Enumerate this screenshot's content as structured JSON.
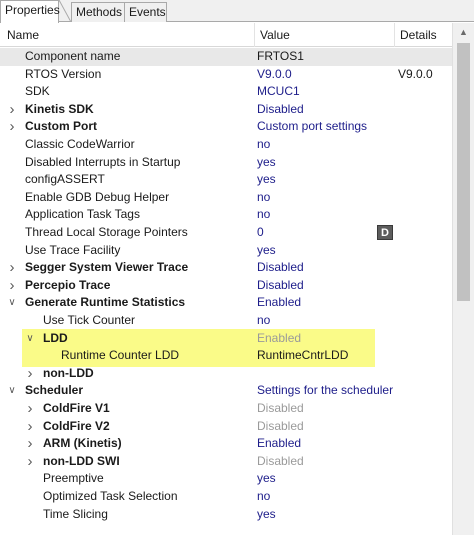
{
  "tabs": [
    {
      "label": "Properties",
      "active": true
    },
    {
      "label": "Methods",
      "active": false
    },
    {
      "label": "Events",
      "active": false
    }
  ],
  "columns": {
    "name": "Name",
    "value": "Value",
    "details": "Details"
  },
  "rows": [
    {
      "name": "Component name",
      "value": "FRTOS1",
      "details": "",
      "indent": 0,
      "twisty": "",
      "bold": false,
      "dim": false,
      "value_style": "dark",
      "selected": true
    },
    {
      "name": "RTOS Version",
      "value": "V9.0.0",
      "details": "V9.0.0",
      "indent": 0,
      "twisty": "",
      "bold": false,
      "dim": false,
      "value_style": "blue"
    },
    {
      "name": "SDK",
      "value": "MCUC1",
      "details": "",
      "indent": 0,
      "twisty": "",
      "bold": false,
      "dim": false,
      "value_style": "blue"
    },
    {
      "name": "Kinetis SDK",
      "value": "Disabled",
      "details": "",
      "indent": 0,
      "twisty": "collapsed",
      "bold": true,
      "dim": false,
      "value_style": "blue"
    },
    {
      "name": "Custom Port",
      "value": "Custom port settings",
      "details": "",
      "indent": 0,
      "twisty": "collapsed",
      "bold": true,
      "dim": false,
      "value_style": "blue"
    },
    {
      "name": "Classic CodeWarrior",
      "value": "no",
      "details": "",
      "indent": 0,
      "twisty": "",
      "bold": false,
      "dim": false,
      "value_style": "blue"
    },
    {
      "name": "Disabled Interrupts in Startup",
      "value": "yes",
      "details": "",
      "indent": 0,
      "twisty": "",
      "bold": false,
      "dim": false,
      "value_style": "blue"
    },
    {
      "name": "configASSERT",
      "value": "yes",
      "details": "",
      "indent": 0,
      "twisty": "",
      "bold": false,
      "dim": false,
      "value_style": "blue"
    },
    {
      "name": "Enable GDB Debug Helper",
      "value": "no",
      "details": "",
      "indent": 0,
      "twisty": "",
      "bold": false,
      "dim": false,
      "value_style": "blue"
    },
    {
      "name": "Application Task Tags",
      "value": "no",
      "details": "",
      "indent": 0,
      "twisty": "",
      "bold": false,
      "dim": false,
      "value_style": "blue"
    },
    {
      "name": "Thread Local Storage Pointers",
      "value": "0",
      "details": "",
      "indent": 0,
      "twisty": "",
      "bold": false,
      "dim": false,
      "value_style": "blue",
      "button": "D"
    },
    {
      "name": "Use Trace Facility",
      "value": "yes",
      "details": "",
      "indent": 0,
      "twisty": "",
      "bold": false,
      "dim": false,
      "value_style": "blue"
    },
    {
      "name": "Segger System Viewer Trace",
      "value": "Disabled",
      "details": "",
      "indent": 0,
      "twisty": "collapsed",
      "bold": true,
      "dim": false,
      "value_style": "blue"
    },
    {
      "name": "Percepio Trace",
      "value": "Disabled",
      "details": "",
      "indent": 0,
      "twisty": "collapsed",
      "bold": true,
      "dim": false,
      "value_style": "blue"
    },
    {
      "name": "Generate Runtime Statistics",
      "value": "Enabled",
      "details": "",
      "indent": 0,
      "twisty": "expanded",
      "bold": true,
      "dim": false,
      "value_style": "blue"
    },
    {
      "name": "Use Tick Counter",
      "value": "no",
      "details": "",
      "indent": 1,
      "twisty": "",
      "bold": false,
      "dim": false,
      "value_style": "blue"
    },
    {
      "name": "LDD",
      "value": "Enabled",
      "details": "",
      "indent": 1,
      "twisty": "expanded",
      "bold": true,
      "dim": false,
      "value_style": "dim"
    },
    {
      "name": "Runtime Counter LDD",
      "value": "RuntimeCntrLDD",
      "details": "",
      "indent": 2,
      "twisty": "",
      "bold": false,
      "dim": false,
      "value_style": "dark"
    },
    {
      "name": "non-LDD",
      "value": "",
      "details": "",
      "indent": 1,
      "twisty": "collapsed",
      "bold": true,
      "dim": false,
      "value_style": "blue"
    },
    {
      "name": "Scheduler",
      "value": "Settings for the scheduler",
      "details": "",
      "indent": 0,
      "twisty": "expanded",
      "bold": true,
      "dim": false,
      "value_style": "blue"
    },
    {
      "name": "ColdFire V1",
      "value": "Disabled",
      "details": "",
      "indent": 1,
      "twisty": "collapsed",
      "bold": true,
      "dim": false,
      "value_style": "dim"
    },
    {
      "name": "ColdFire V2",
      "value": "Disabled",
      "details": "",
      "indent": 1,
      "twisty": "collapsed",
      "bold": true,
      "dim": false,
      "value_style": "dim"
    },
    {
      "name": "ARM (Kinetis)",
      "value": "Enabled",
      "details": "",
      "indent": 1,
      "twisty": "collapsed",
      "bold": true,
      "dim": false,
      "value_style": "blue"
    },
    {
      "name": "non-LDD SWI",
      "value": "Disabled",
      "details": "",
      "indent": 1,
      "twisty": "collapsed",
      "bold": true,
      "dim": false,
      "value_style": "dim"
    },
    {
      "name": "Preemptive",
      "value": "yes",
      "details": "",
      "indent": 1,
      "twisty": "",
      "bold": false,
      "dim": false,
      "value_style": "blue"
    },
    {
      "name": "Optimized Task Selection",
      "value": "no",
      "details": "",
      "indent": 1,
      "twisty": "",
      "bold": false,
      "dim": false,
      "value_style": "blue"
    },
    {
      "name": "Time Slicing",
      "value": "yes",
      "details": "",
      "indent": 1,
      "twisty": "",
      "bold": false,
      "dim": false,
      "value_style": "blue"
    }
  ],
  "colors": {
    "highlight": "#f9fb7b",
    "value_blue": "#1d1d8a",
    "value_dim": "#9a9a9a"
  }
}
